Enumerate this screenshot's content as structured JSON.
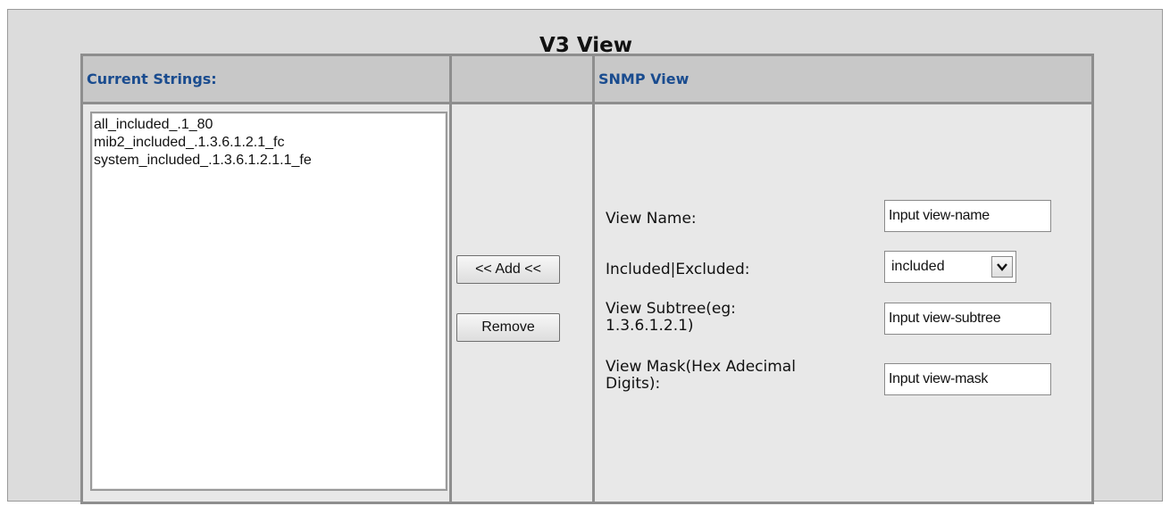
{
  "title": "V3 View",
  "headers": {
    "current_strings": "Current Strings:",
    "snmp_view": "SNMP View"
  },
  "current_strings": [
    "all_included_.1_80",
    "mib2_included_.1.3.6.1.2.1_fc",
    "system_included_.1.3.6.1.2.1.1_fe"
  ],
  "buttons": {
    "add": "<< Add <<",
    "remove": "Remove"
  },
  "form": {
    "view_name_label": "View Name:",
    "view_name_value": "Input view-name",
    "included_label": "Included|Excluded:",
    "included_value": "included",
    "subtree_label_line1": "View Subtree(eg:",
    "subtree_label_line2": "1.3.6.1.2.1)",
    "subtree_value": "Input view-subtree",
    "mask_label_line1": "View Mask(Hex Adecimal",
    "mask_label_line2": "Digits):",
    "mask_value": "Input view-mask"
  },
  "icons": {
    "dropdown": "chevron-down-icon"
  }
}
